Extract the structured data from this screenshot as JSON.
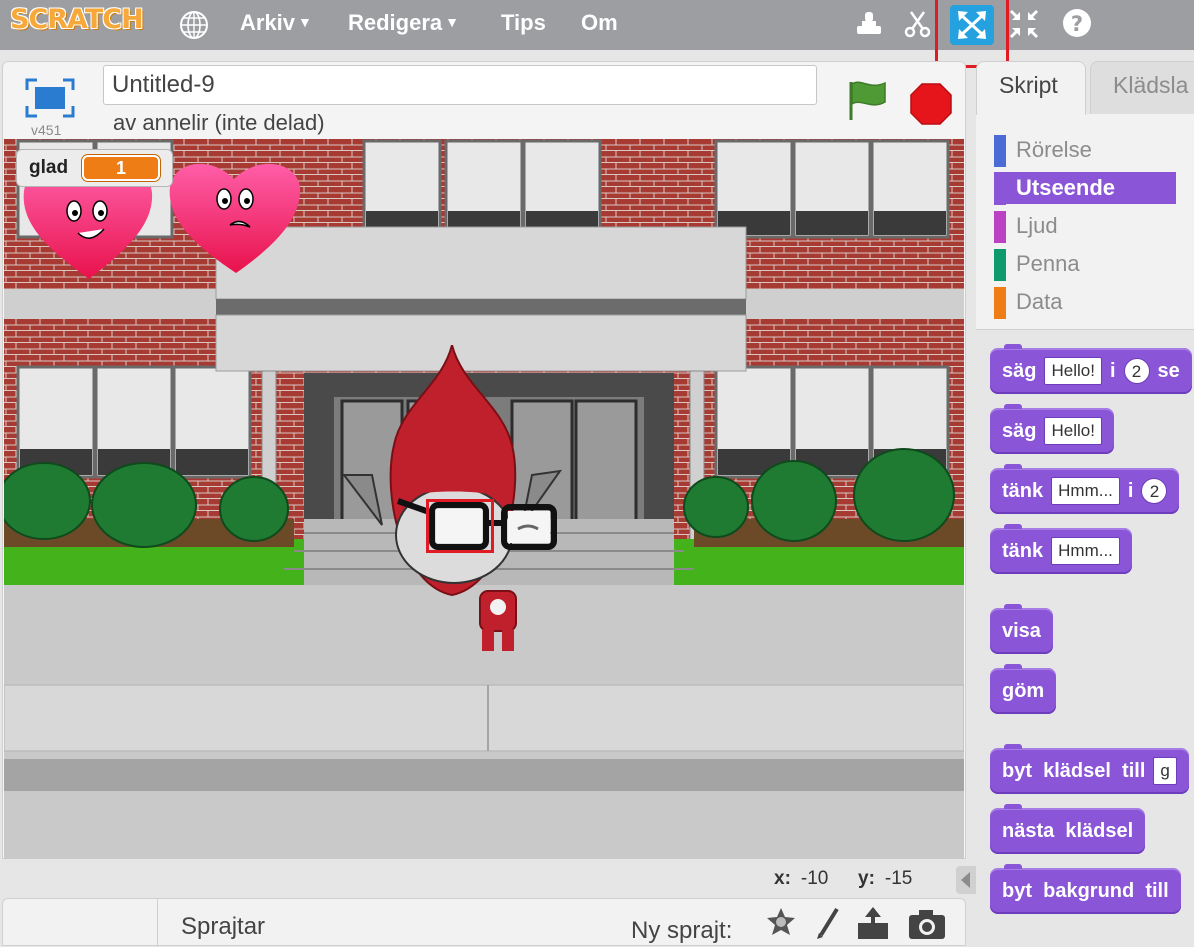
{
  "topbar": {
    "logo": "SCRATCH",
    "menu": [
      {
        "label": "Arkiv",
        "has_caret": true
      },
      {
        "label": "Redigera",
        "has_caret": true
      },
      {
        "label": "Tips",
        "has_caret": false
      },
      {
        "label": "Om",
        "has_caret": false
      }
    ],
    "tools": [
      "duplicate-stamp-icon",
      "cut-scissors-icon",
      "grow-arrows-icon",
      "shrink-arrows-icon",
      "help-icon"
    ],
    "active_tool": "grow-arrows-icon",
    "colors": {
      "bar": "#9c9ea2",
      "active_tool": "#25a1e0",
      "highlight": "#e01b24"
    }
  },
  "project": {
    "title": "Untitled-9",
    "author_line": "av annelir (inte delad)",
    "version": "v451"
  },
  "stage": {
    "variable": {
      "name": "glad",
      "value": "1"
    },
    "mouse": {
      "x_label": "x:",
      "x_value": "-10",
      "y_label": "y:",
      "y_value": "-15"
    }
  },
  "sprites_pane": {
    "label": "Sprajtar",
    "new_sprite_label": "Ny sprajt:",
    "new_sprite_icons": [
      "sprite-library-icon",
      "paint-brush-icon",
      "upload-icon",
      "camera-icon"
    ]
  },
  "tabs": [
    {
      "label": "Skript",
      "active": true
    },
    {
      "label": "Klädsla",
      "active": false
    }
  ],
  "categories": [
    {
      "label": "Rörelse",
      "color": "#4a6cd4",
      "selected": false
    },
    {
      "label": "Utseende",
      "color": "#8a55d7",
      "selected": true
    },
    {
      "label": "Ljud",
      "color": "#bb42c3",
      "selected": false
    },
    {
      "label": "Penna",
      "color": "#0e9a6c",
      "selected": false
    },
    {
      "label": "Data",
      "color": "#ee7d16",
      "selected": false
    }
  ],
  "blocks": [
    {
      "parts": [
        "säg",
        "Hello!",
        "i",
        "2",
        "se"
      ],
      "types": [
        "t",
        "s",
        "t",
        "n",
        "t"
      ]
    },
    {
      "parts": [
        "säg",
        "Hello!"
      ],
      "types": [
        "t",
        "s"
      ]
    },
    {
      "parts": [
        "tänk",
        "Hmm...",
        "i",
        "2"
      ],
      "types": [
        "t",
        "s",
        "t",
        "n"
      ]
    },
    {
      "parts": [
        "tänk",
        "Hmm..."
      ],
      "types": [
        "t",
        "s"
      ]
    },
    {
      "parts": [
        "visa"
      ],
      "types": [
        "t"
      ]
    },
    {
      "parts": [
        "göm"
      ],
      "types": [
        "t"
      ]
    },
    {
      "parts": [
        "byt  klädsel  till",
        "g"
      ],
      "types": [
        "t",
        "s"
      ]
    },
    {
      "parts": [
        "nästa  klädsel"
      ],
      "types": [
        "t"
      ]
    },
    {
      "parts": [
        "byt  bakgrund  till"
      ],
      "types": [
        "t"
      ]
    }
  ]
}
